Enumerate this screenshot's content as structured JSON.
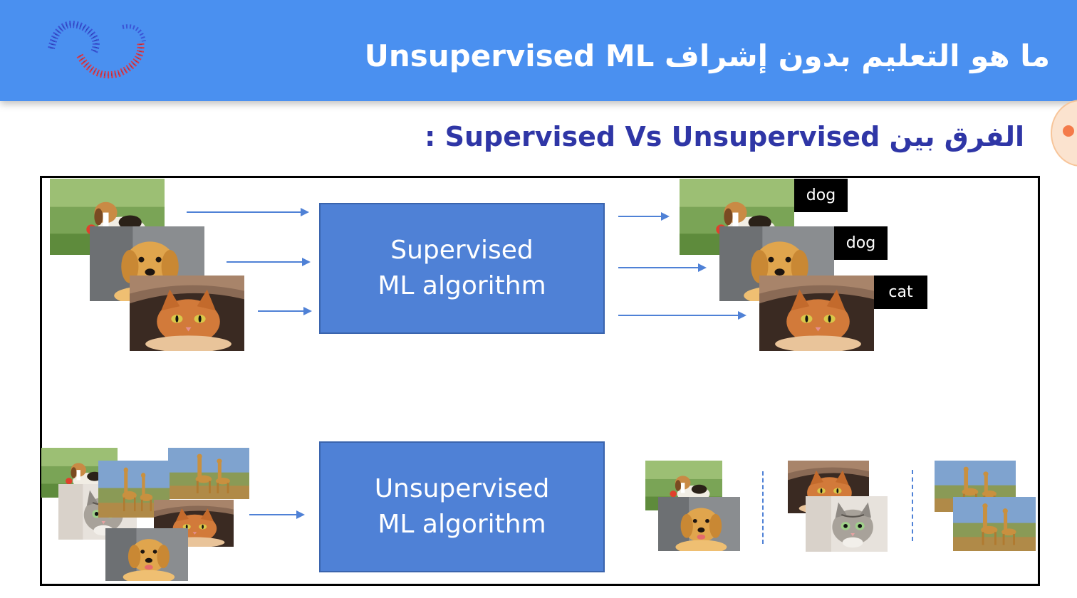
{
  "header": {
    "title": "ما هو التعليم بدون إشراف Unsupervised ML"
  },
  "subtitle": "الفرق بين Supervised Vs Unsupervised :",
  "supervised": {
    "box_line1": "Supervised",
    "box_line2": "ML algorithm",
    "labels": [
      "dog",
      "dog",
      "cat"
    ]
  },
  "unsupervised": {
    "box_line1": "Unsupervised",
    "box_line2": "ML algorithm"
  },
  "colors": {
    "header_bg": "#4a90f0",
    "box_fill": "#4f81d6",
    "subtitle_text": "#2f36a6"
  }
}
